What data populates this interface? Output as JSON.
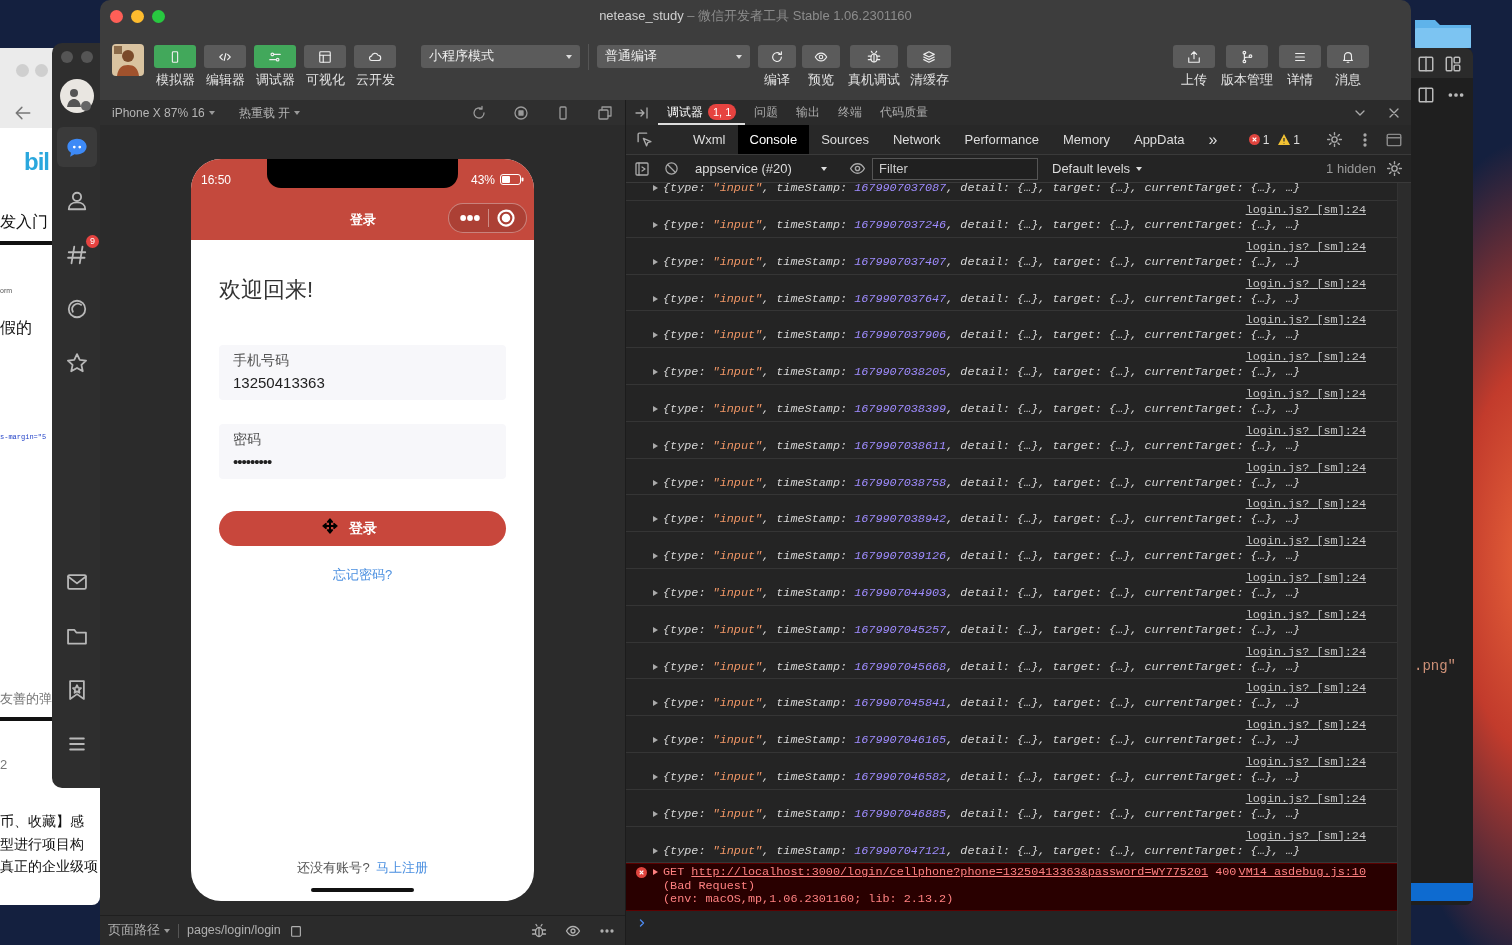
{
  "desktop": {
    "browser_window": {
      "logo": "bil",
      "texts": [
        {
          "kind": "title",
          "text": "发入门"
        },
        {
          "kind": "tiny",
          "text": "orm"
        },
        {
          "kind": "title",
          "text": "假的"
        },
        {
          "kind": "code",
          "text": "s-margin=\"5"
        },
        {
          "kind": "caption",
          "text": "友善的弹"
        },
        {
          "kind": "caption",
          "text": "2"
        },
        {
          "kind": "body",
          "text": "币、收藏】感"
        },
        {
          "kind": "body",
          "text": "型进行项目构"
        },
        {
          "kind": "body",
          "text": "真正的企业级项"
        }
      ]
    },
    "chat_app": {
      "items": [
        {
          "kind": "chat",
          "selected": true
        },
        {
          "kind": "contacts",
          "selected": false
        },
        {
          "kind": "moments",
          "selected": false,
          "badge": "9"
        },
        {
          "kind": "discover",
          "selected": false
        },
        {
          "kind": "favorites",
          "selected": false
        },
        {
          "kind": "mail",
          "selected": false
        },
        {
          "kind": "files",
          "selected": false
        },
        {
          "kind": "bookmarks",
          "selected": false
        },
        {
          "kind": "menu",
          "selected": false
        }
      ]
    },
    "editor_window": {
      "text": ".png\""
    }
  },
  "window": {
    "title": "netease_study",
    "subtitle": "– 微信开发者工具 Stable 1.06.2301160"
  },
  "toolbar": {
    "left_buttons": [
      {
        "label": "模拟器",
        "active": true
      },
      {
        "label": "编辑器",
        "active": false
      },
      {
        "label": "调试器",
        "active": true
      },
      {
        "label": "可视化",
        "active": false
      },
      {
        "label": "云开发",
        "active": false
      }
    ],
    "mode_select": "小程序模式",
    "compile_select": "普通编译",
    "mid_buttons": [
      {
        "label": "编译"
      },
      {
        "label": "预览"
      },
      {
        "label": "真机调试"
      },
      {
        "label": "清缓存"
      }
    ],
    "right_buttons": [
      {
        "label": "上传"
      },
      {
        "label": "版本管理"
      },
      {
        "label": "详情"
      },
      {
        "label": "消息"
      }
    ]
  },
  "simulator": {
    "device": "iPhone X 87% 16",
    "hot_reload": "热重载 开",
    "phone": {
      "time": "16:50",
      "battery": "43%",
      "nav_title": "登录",
      "heading": "欢迎回来!",
      "fields": [
        {
          "label": "手机号码",
          "value": "13250413363"
        },
        {
          "label": "密码",
          "value": "•••••••••"
        }
      ],
      "login_button": "登录",
      "forgot_link": "忘记密码?",
      "footer_text": "还没有账号?",
      "register_link": "马上注册"
    },
    "path_label": "页面路径",
    "path": "pages/login/login"
  },
  "devtools": {
    "top_tabs": [
      {
        "label": "调试器",
        "selected": true,
        "badge": "1, 1"
      },
      {
        "label": "问题",
        "selected": false
      },
      {
        "label": "输出",
        "selected": false
      },
      {
        "label": "终端",
        "selected": false
      },
      {
        "label": "代码质量",
        "selected": false
      }
    ],
    "panel_tabs": [
      {
        "label": "Wxml",
        "selected": false
      },
      {
        "label": "Console",
        "selected": true
      },
      {
        "label": "Sources",
        "selected": false
      },
      {
        "label": "Network",
        "selected": false
      },
      {
        "label": "Performance",
        "selected": false
      },
      {
        "label": "Memory",
        "selected": false
      },
      {
        "label": "AppData",
        "selected": false
      }
    ],
    "more": "»",
    "error_count": "1",
    "warning_count": "1",
    "context": "appservice (#20)",
    "filter_placeholder": "Filter",
    "levels": "Default levels",
    "hidden": "1 hidden",
    "logs": [
      {
        "head": "{type: ",
        "type": "\"input\"",
        "mid": ", timeStamp: ",
        "timestamp": "1679907037087",
        "tail": ", detail: {…}, target: {…}, currentTarget: {…}, …}"
      },
      {
        "link": "login.js? [sm]:24",
        "head": "{type: ",
        "type": "\"input\"",
        "mid": ", timeStamp: ",
        "timestamp": "1679907037246",
        "tail": ", detail: {…}, target: {…}, currentTarget: {…}, …}"
      },
      {
        "link": "login.js? [sm]:24",
        "head": "{type: ",
        "type": "\"input\"",
        "mid": ", timeStamp: ",
        "timestamp": "1679907037407",
        "tail": ", detail: {…}, target: {…}, currentTarget: {…}, …}"
      },
      {
        "link": "login.js? [sm]:24",
        "head": "{type: ",
        "type": "\"input\"",
        "mid": ", timeStamp: ",
        "timestamp": "1679907037647",
        "tail": ", detail: {…}, target: {…}, currentTarget: {…}, …}"
      },
      {
        "link": "login.js? [sm]:24",
        "head": "{type: ",
        "type": "\"input\"",
        "mid": ", timeStamp: ",
        "timestamp": "1679907037906",
        "tail": ", detail: {…}, target: {…}, currentTarget: {…}, …}"
      },
      {
        "link": "login.js? [sm]:24",
        "head": "{type: ",
        "type": "\"input\"",
        "mid": ", timeStamp: ",
        "timestamp": "1679907038205",
        "tail": ", detail: {…}, target: {…}, currentTarget: {…}, …}"
      },
      {
        "link": "login.js? [sm]:24",
        "head": "{type: ",
        "type": "\"input\"",
        "mid": ", timeStamp: ",
        "timestamp": "1679907038399",
        "tail": ", detail: {…}, target: {…}, currentTarget: {…}, …}"
      },
      {
        "link": "login.js? [sm]:24",
        "head": "{type: ",
        "type": "\"input\"",
        "mid": ", timeStamp: ",
        "timestamp": "1679907038611",
        "tail": ", detail: {…}, target: {…}, currentTarget: {…}, …}"
      },
      {
        "link": "login.js? [sm]:24",
        "head": "{type: ",
        "type": "\"input\"",
        "mid": ", timeStamp: ",
        "timestamp": "1679907038758",
        "tail": ", detail: {…}, target: {…}, currentTarget: {…}, …}"
      },
      {
        "link": "login.js? [sm]:24",
        "head": "{type: ",
        "type": "\"input\"",
        "mid": ", timeStamp: ",
        "timestamp": "1679907038942",
        "tail": ", detail: {…}, target: {…}, currentTarget: {…}, …}"
      },
      {
        "link": "login.js? [sm]:24",
        "head": "{type: ",
        "type": "\"input\"",
        "mid": ", timeStamp: ",
        "timestamp": "1679907039126",
        "tail": ", detail: {…}, target: {…}, currentTarget: {…}, …}"
      },
      {
        "link": "login.js? [sm]:24",
        "head": "{type: ",
        "type": "\"input\"",
        "mid": ", timeStamp: ",
        "timestamp": "1679907044903",
        "tail": ", detail: {…}, target: {…}, currentTarget: {…}, …}"
      },
      {
        "link": "login.js? [sm]:24",
        "head": "{type: ",
        "type": "\"input\"",
        "mid": ", timeStamp: ",
        "timestamp": "1679907045257",
        "tail": ", detail: {…}, target: {…}, currentTarget: {…}, …}"
      },
      {
        "link": "login.js? [sm]:24",
        "head": "{type: ",
        "type": "\"input\"",
        "mid": ", timeStamp: ",
        "timestamp": "1679907045668",
        "tail": ", detail: {…}, target: {…}, currentTarget: {…}, …}"
      },
      {
        "link": "login.js? [sm]:24",
        "head": "{type: ",
        "type": "\"input\"",
        "mid": ", timeStamp: ",
        "timestamp": "1679907045841",
        "tail": ", detail: {…}, target: {…}, currentTarget: {…}, …}"
      },
      {
        "link": "login.js? [sm]:24",
        "head": "{type: ",
        "type": "\"input\"",
        "mid": ", timeStamp: ",
        "timestamp": "1679907046165",
        "tail": ", detail: {…}, target: {…}, currentTarget: {…}, …}"
      },
      {
        "link": "login.js? [sm]:24",
        "head": "{type: ",
        "type": "\"input\"",
        "mid": ", timeStamp: ",
        "timestamp": "1679907046582",
        "tail": ", detail: {…}, target: {…}, currentTarget: {…}, …}"
      },
      {
        "link": "login.js? [sm]:24",
        "head": "{type: ",
        "type": "\"input\"",
        "mid": ", timeStamp: ",
        "timestamp": "1679907046885",
        "tail": ", detail: {…}, target: {…}, currentTarget: {…}, …}"
      },
      {
        "link": "login.js? [sm]:24",
        "head": "{type: ",
        "type": "\"input\"",
        "mid": ", timeStamp: ",
        "timestamp": "1679907047121",
        "tail": ", detail: {…}, target: {…}, currentTarget: {…}, …}"
      }
    ],
    "error": {
      "method": "GET",
      "url": "http://localhost:3000/login/cellphone?phone=13250413363&password=WY775201",
      "status": "400",
      "source": "VM14 asdebug.js:10",
      "detail": "(Bad Request)",
      "env": "(env: macOS,mp,1.06.2301160; lib: 2.13.2)"
    }
  }
}
